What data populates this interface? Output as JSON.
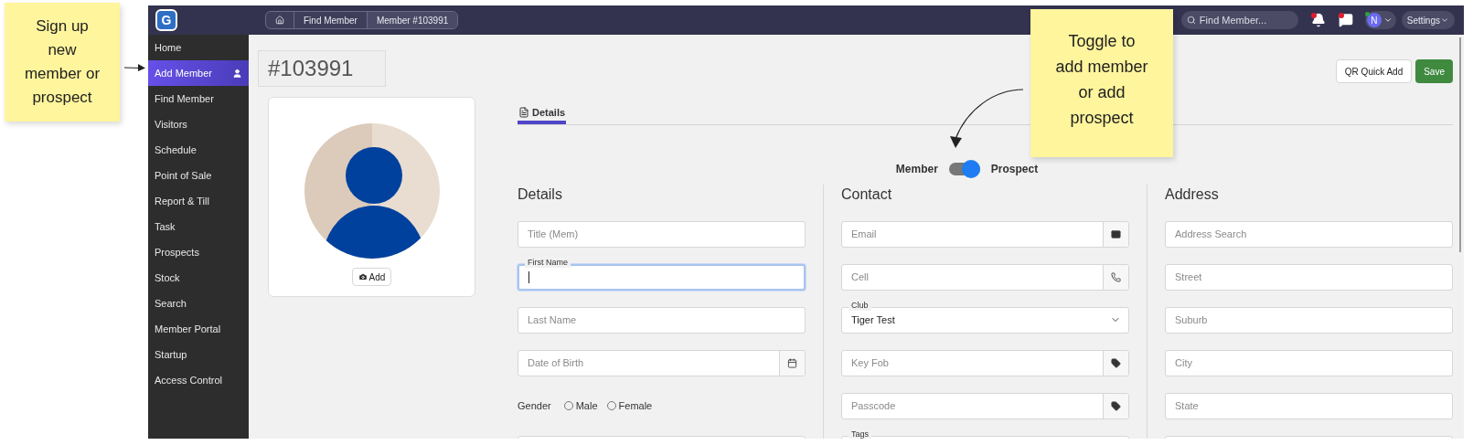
{
  "annotations": [
    {
      "text": "Sign up new member or prospect"
    },
    {
      "text": "Toggle to add member or add prospect"
    }
  ],
  "topbar": {
    "logo": "G",
    "breadcrumbs": [
      "Find Member",
      "Member #103991"
    ],
    "search": {
      "placeholder": "Find Member..."
    },
    "avatar": "N",
    "settings": "Settings"
  },
  "sidebar": {
    "items": [
      {
        "label": "Home",
        "selected": false
      },
      {
        "label": "Add Member",
        "selected": true
      },
      {
        "label": "Find Member",
        "selected": false
      },
      {
        "label": "Visitors",
        "selected": false
      },
      {
        "label": "Schedule",
        "selected": false
      },
      {
        "label": "Point of Sale",
        "selected": false
      },
      {
        "label": "Report & Till",
        "selected": false
      },
      {
        "label": "Task",
        "selected": false
      },
      {
        "label": "Prospects",
        "selected": false
      },
      {
        "label": "Stock",
        "selected": false
      },
      {
        "label": "Search",
        "selected": false
      },
      {
        "label": "Member Portal",
        "selected": false
      },
      {
        "label": "Startup",
        "selected": false
      },
      {
        "label": "Access Control",
        "selected": false
      }
    ]
  },
  "member_id": "#103991",
  "photo": {
    "add_button": "Add"
  },
  "actions": [
    {
      "label": "QR Quick Add",
      "kind": "secondary"
    },
    {
      "label": "Save",
      "kind": "primary"
    }
  ],
  "tabs": [
    {
      "label": "Details",
      "selected": true
    }
  ],
  "type_toggle": {
    "left": "Member",
    "right": "Prospect",
    "on": true
  },
  "sections": [
    {
      "title": "Details",
      "fields": [
        {
          "kind": "text",
          "placeholder": "Title (Mem)",
          "focused": false
        },
        {
          "kind": "text",
          "label": "First Name",
          "focused": true
        },
        {
          "kind": "text",
          "placeholder": "Last Name",
          "focused": false
        },
        {
          "kind": "date",
          "placeholder": "Date of Birth",
          "focused": false
        },
        {
          "kind": "radio",
          "label": "Gender",
          "options": [
            {
              "label": "Male",
              "selected": false
            },
            {
              "label": "Female",
              "selected": false
            }
          ]
        },
        {
          "kind": "text",
          "focused": false
        }
      ]
    },
    {
      "title": "Contact",
      "fields": [
        {
          "kind": "email",
          "placeholder": "Email",
          "focused": false
        },
        {
          "kind": "phone",
          "placeholder": "Cell",
          "focused": false
        },
        {
          "kind": "select",
          "label": "Club",
          "value": "Tiger Test",
          "focused": false
        },
        {
          "kind": "tag",
          "placeholder": "Key Fob",
          "focused": false
        },
        {
          "kind": "tag",
          "placeholder": "Passcode",
          "focused": false
        },
        {
          "kind": "text",
          "label": "Tags",
          "focused": false
        }
      ]
    },
    {
      "title": "Address",
      "fields": [
        {
          "kind": "text",
          "placeholder": "Address Search",
          "focused": false
        },
        {
          "kind": "text",
          "placeholder": "Street",
          "focused": false
        },
        {
          "kind": "text",
          "placeholder": "Suburb",
          "focused": false
        },
        {
          "kind": "text",
          "placeholder": "City",
          "focused": false
        },
        {
          "kind": "text",
          "placeholder": "State",
          "focused": false
        },
        {
          "kind": "text",
          "focused": false
        }
      ]
    }
  ]
}
